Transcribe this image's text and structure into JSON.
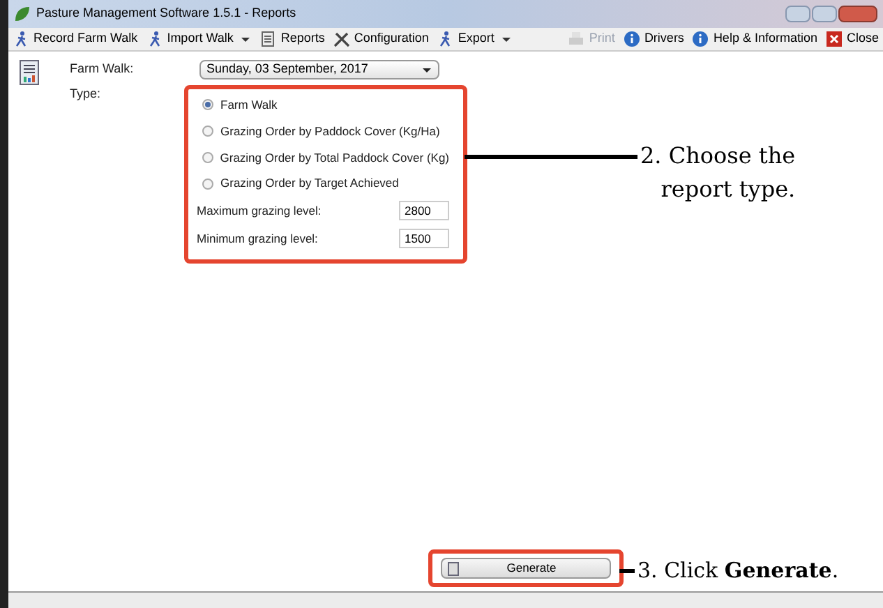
{
  "window": {
    "title": "Pasture Management Software 1.5.1 - Reports"
  },
  "toolbar": {
    "left": [
      {
        "label": "Record Farm Walk",
        "kind": "walker",
        "dropdown": false
      },
      {
        "label": "Import Walk",
        "kind": "walker",
        "dropdown": true
      },
      {
        "label": "Reports",
        "kind": "report",
        "dropdown": false
      },
      {
        "label": "Configuration",
        "kind": "tools",
        "dropdown": false
      },
      {
        "label": "Export",
        "kind": "walker",
        "dropdown": true
      }
    ],
    "right": [
      {
        "label": "Print",
        "kind": "printer",
        "disabled": true
      },
      {
        "label": "Drivers",
        "kind": "info",
        "disabled": false
      },
      {
        "label": "Help & Information",
        "kind": "info",
        "disabled": false
      },
      {
        "label": "Close",
        "kind": "close",
        "disabled": false
      }
    ]
  },
  "form": {
    "farm_walk_label": "Farm Walk:",
    "farm_walk_value": "Sunday, 03 September, 2017",
    "type_label": "Type:",
    "report_types": [
      {
        "label": "Farm Walk",
        "selected": true
      },
      {
        "label": "Grazing Order by Paddock Cover (Kg/Ha)",
        "selected": false
      },
      {
        "label": "Grazing Order by Total Paddock Cover (Kg)",
        "selected": false
      },
      {
        "label": "Grazing Order by Target Achieved",
        "selected": false
      }
    ],
    "levels": [
      {
        "label": "Maximum grazing level:",
        "value": "2800"
      },
      {
        "label": "Minimum grazing level:",
        "value": "1500"
      }
    ],
    "generate": "Generate"
  },
  "annotations": [
    {
      "lines": [
        "2. Choose the",
        "report type."
      ]
    },
    {
      "lines": [
        "3. Click **Generate**."
      ]
    }
  ]
}
